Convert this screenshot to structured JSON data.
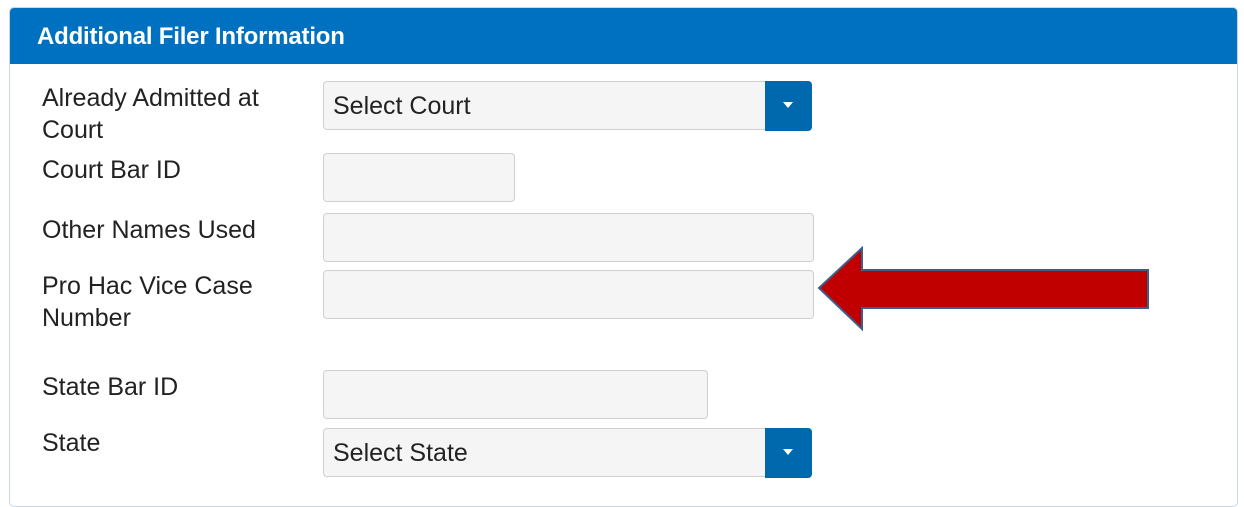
{
  "panel": {
    "title": "Additional Filer Information"
  },
  "fields": {
    "already_admitted_label_line1": "Already Admitted at",
    "already_admitted_label_line2": "Court",
    "already_admitted_value": "Select Court",
    "court_bar_id_label": "Court Bar ID",
    "court_bar_id_value": "",
    "other_names_label": "Other Names Used",
    "other_names_value": "",
    "pro_hac_label_line1": "Pro Hac Vice Case",
    "pro_hac_label_line2": "Number",
    "pro_hac_value": "",
    "state_bar_id_label": "State Bar ID",
    "state_bar_id_value": "",
    "state_label": "State",
    "state_value": "Select State"
  },
  "annotation": {
    "arrow_color": "#c00000",
    "arrow_outline": "#3b5f8a"
  },
  "colors": {
    "header_bg": "#0071c1",
    "select_button_bg": "#0068ad"
  }
}
